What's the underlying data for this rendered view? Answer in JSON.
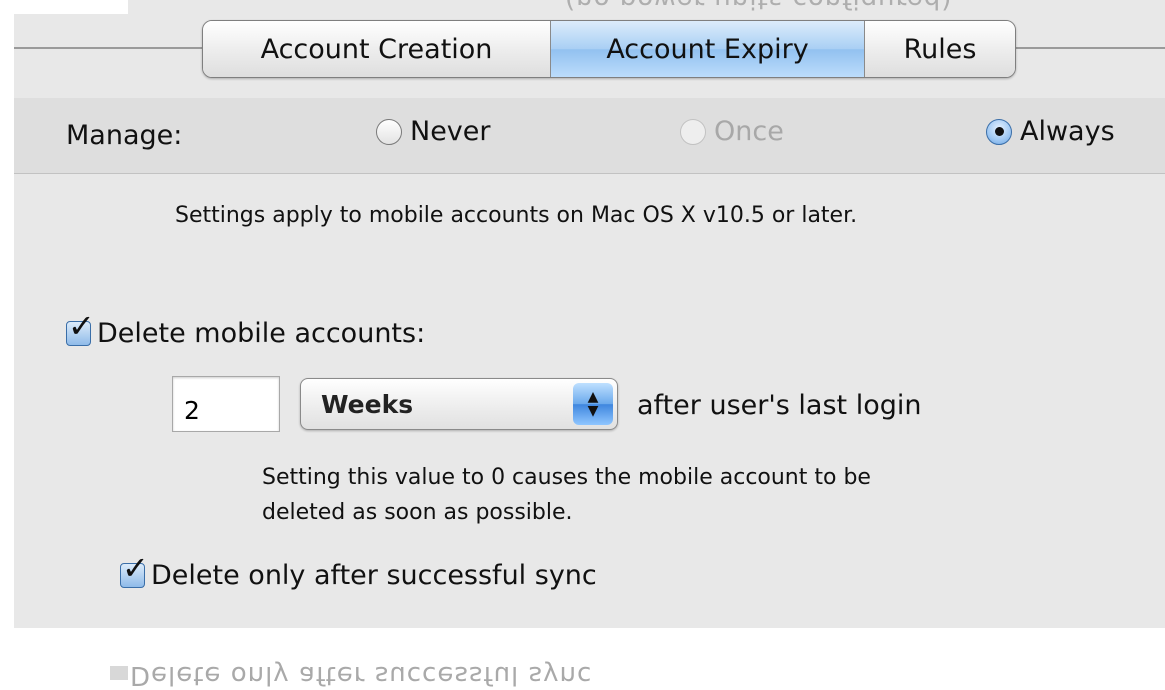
{
  "header": {
    "ghost_text": "(no power units configured)"
  },
  "tabs": [
    {
      "label": "Account Creation",
      "active": false
    },
    {
      "label": "Account Expiry",
      "active": true
    },
    {
      "label": "Rules",
      "active": false
    }
  ],
  "manage": {
    "label": "Manage:",
    "options": [
      {
        "label": "Never",
        "selected": false,
        "enabled": true
      },
      {
        "label": "Once",
        "selected": false,
        "enabled": false
      },
      {
        "label": "Always",
        "selected": true,
        "enabled": true
      }
    ]
  },
  "settings_note": "Settings apply to mobile accounts on Mac OS X v10.5 or later.",
  "delete_accounts": {
    "label": "Delete mobile accounts:",
    "checked": true,
    "value": "2",
    "unit": "Weeks",
    "after_text": "after user's last login",
    "hint_line1": "Setting this value to 0 causes the mobile account to be",
    "hint_line2": "deleted as soon as possible."
  },
  "delete_after_sync": {
    "label": "Delete only after successful sync",
    "checked": true
  },
  "footer": {
    "ghost_text": "Delete only after successful sync"
  },
  "colors": {
    "panel": "#e8e8e8",
    "active_tab": "#a9cff4",
    "checkbox": "#8fbbe9"
  }
}
